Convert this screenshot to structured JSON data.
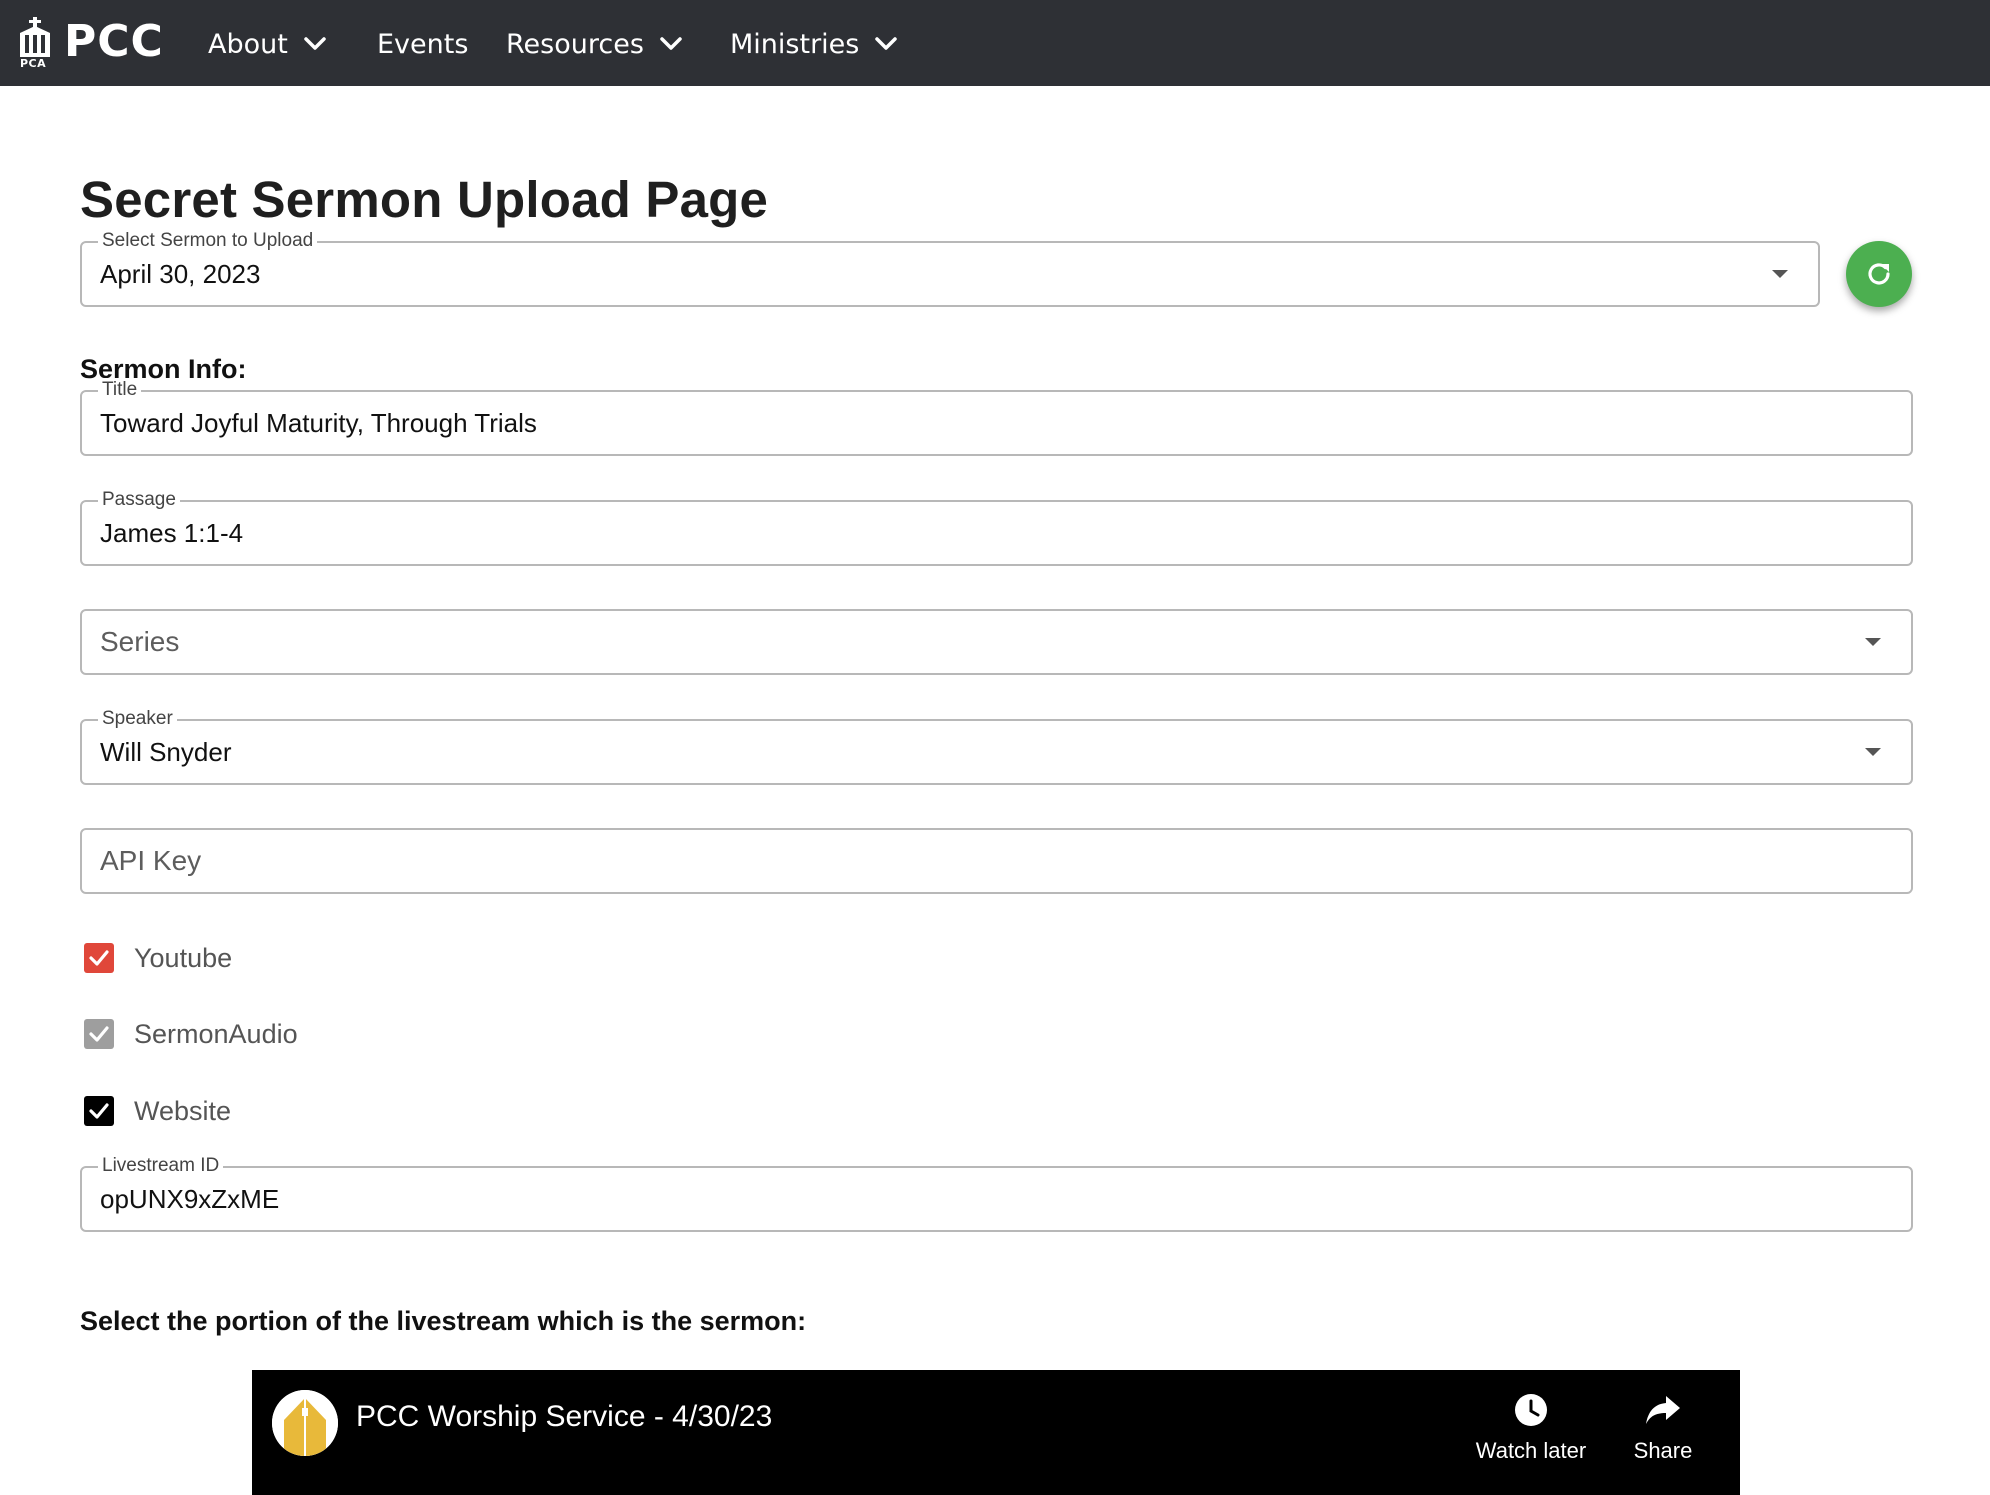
{
  "nav": {
    "logo_text": "PCC",
    "logo_sub": "PCA",
    "items": [
      {
        "label": "About"
      },
      {
        "label": "Events"
      },
      {
        "label": "Resources"
      },
      {
        "label": "Ministries"
      }
    ]
  },
  "page": {
    "title": "Secret Sermon Upload Page",
    "sermon_select": {
      "label": "Select Sermon to Upload",
      "value": "April 30, 2023"
    },
    "sermon_info_label": "Sermon Info:",
    "fields": {
      "title": {
        "label": "Title",
        "value": "Toward Joyful Maturity, Through Trials"
      },
      "passage": {
        "label": "Passage",
        "value": "James 1:1-4"
      },
      "series": {
        "placeholder": "Series"
      },
      "speaker": {
        "label": "Speaker",
        "value": "Will Snyder"
      },
      "api_key": {
        "placeholder": "API Key"
      },
      "livestream": {
        "label": "Livestream ID",
        "value": "opUNX9xZxME"
      }
    },
    "checkboxes": [
      {
        "label": "Youtube",
        "checked": true,
        "color": "#e0473a"
      },
      {
        "label": "SermonAudio",
        "checked": true,
        "color": "#9e9e9e"
      },
      {
        "label": "Website",
        "checked": true,
        "color": "#000000"
      }
    ],
    "portion_label": "Select the portion of the livestream which is the sermon:"
  },
  "video": {
    "title": "PCC Worship Service - 4/30/23",
    "watch_later": "Watch later",
    "share": "Share"
  },
  "colors": {
    "navbar": "#2e3035",
    "refresh_button": "#4caf50"
  },
  "icons": {
    "refresh": "refresh-icon",
    "caret": "caret-down-icon",
    "chevron": "chevron-down-icon",
    "clock": "clock-icon",
    "share": "share-arrow-icon"
  }
}
